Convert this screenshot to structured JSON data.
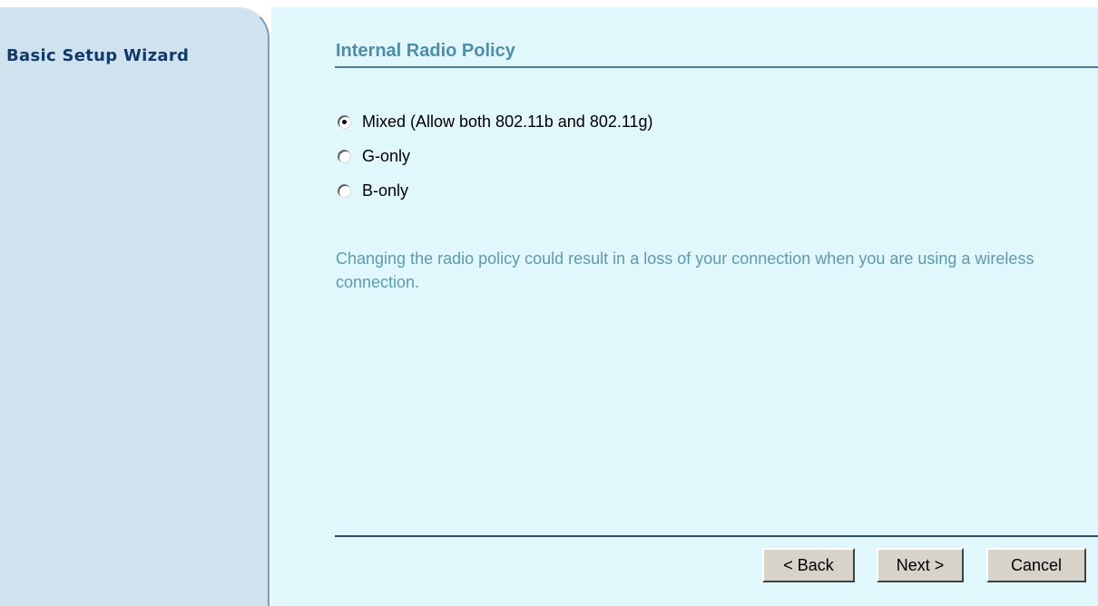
{
  "sidebar": {
    "title": "Basic Setup Wizard"
  },
  "main": {
    "title": "Internal Radio Policy",
    "options": [
      {
        "label": "Mixed (Allow both 802.11b and 802.11g)",
        "selected": true
      },
      {
        "label": "G-only",
        "selected": false
      },
      {
        "label": "B-only",
        "selected": false
      }
    ],
    "note": "Changing the radio policy could result in a loss of your connection when you are using a wireless connection."
  },
  "buttons": {
    "back": "< Back",
    "next": "Next >",
    "cancel": "Cancel"
  },
  "colors": {
    "sidebar_bg": "#cfe2ee",
    "main_bg": "#e0f7fc",
    "title": "#4f8ea8",
    "sidebar_title": "#113a6b",
    "note_text": "#5d9ab0",
    "button_face": "#d7d3ca"
  }
}
